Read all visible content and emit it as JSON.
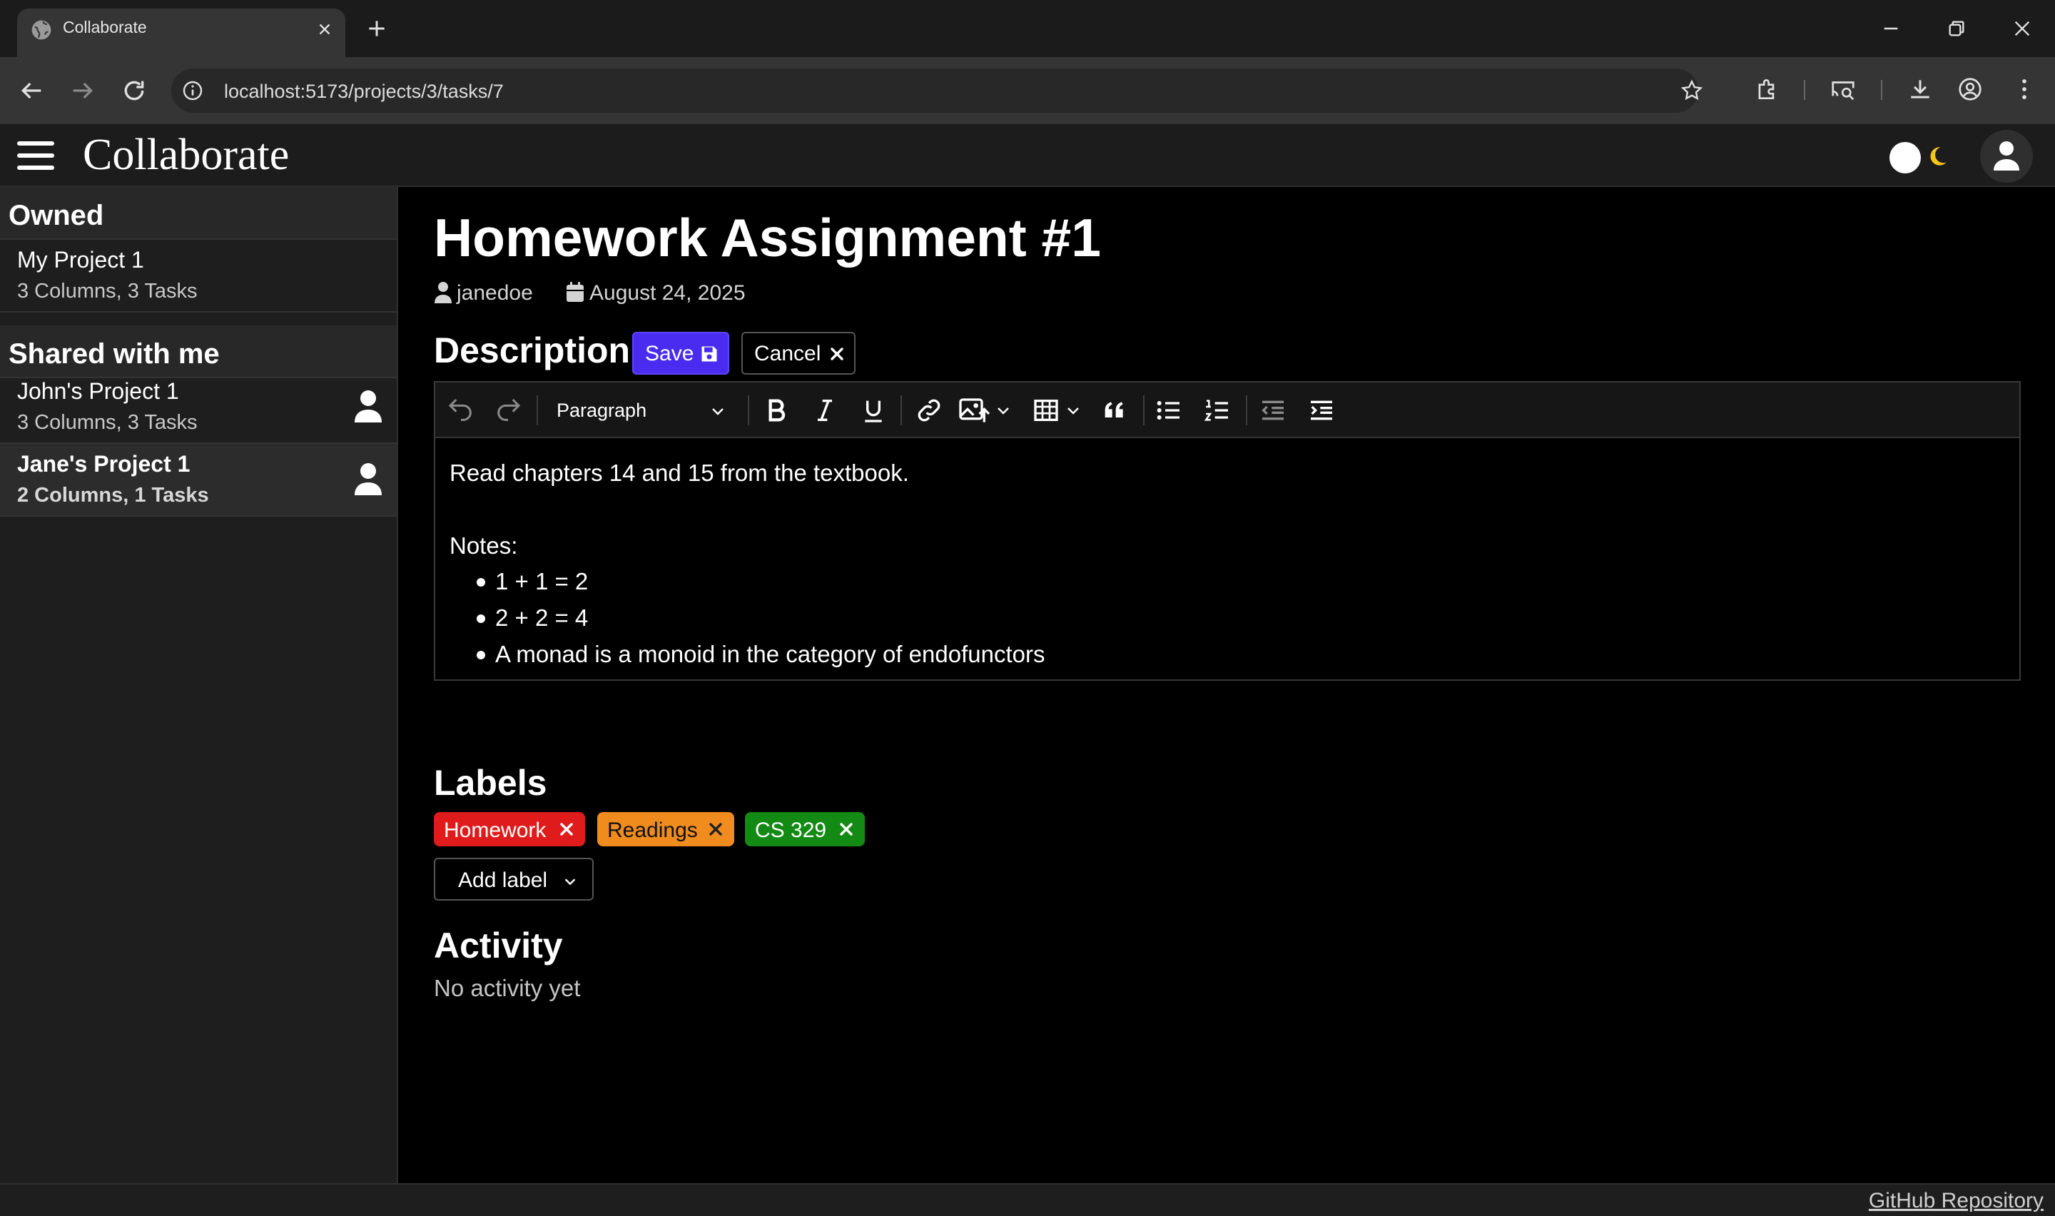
{
  "browser": {
    "tab_title": "Collaborate",
    "url": "localhost:5173/projects/3/tasks/7"
  },
  "header": {
    "app_title": "Collaborate"
  },
  "sidebar": {
    "owned_heading": "Owned",
    "shared_heading": "Shared with me",
    "owned": [
      {
        "name": "My Project 1",
        "meta": "3 Columns, 3 Tasks"
      }
    ],
    "shared": [
      {
        "name": "John's Project 1",
        "meta": "3 Columns, 3 Tasks"
      },
      {
        "name": "Jane's Project 1",
        "meta": "2 Columns, 1 Tasks",
        "active": true
      }
    ]
  },
  "task": {
    "title": "Homework Assignment #1",
    "author": "janedoe",
    "date": "August 24, 2025",
    "description_heading": "Description",
    "save_label": "Save",
    "cancel_label": "Cancel",
    "editor": {
      "block_type": "Paragraph",
      "lines": [
        "Read chapters 14 and 15 from the textbook.",
        "Notes:"
      ],
      "bullets": [
        "1 + 1 = 2",
        "2 + 2 = 4",
        "A monad is a monoid in the category of endofunctors"
      ]
    },
    "labels_heading": "Labels",
    "labels": [
      {
        "text": "Homework",
        "color": "#e01b1b"
      },
      {
        "text": "Readings",
        "color": "#f08c1e"
      },
      {
        "text": "CS 329",
        "color": "#138a13"
      }
    ],
    "add_label": "Add label",
    "activity_heading": "Activity",
    "activity_empty": "No activity yet"
  },
  "footer": {
    "github_link": "GitHub Repository"
  },
  "colors": {
    "accent": "#4a2bf0",
    "moon": "#f5c518"
  }
}
